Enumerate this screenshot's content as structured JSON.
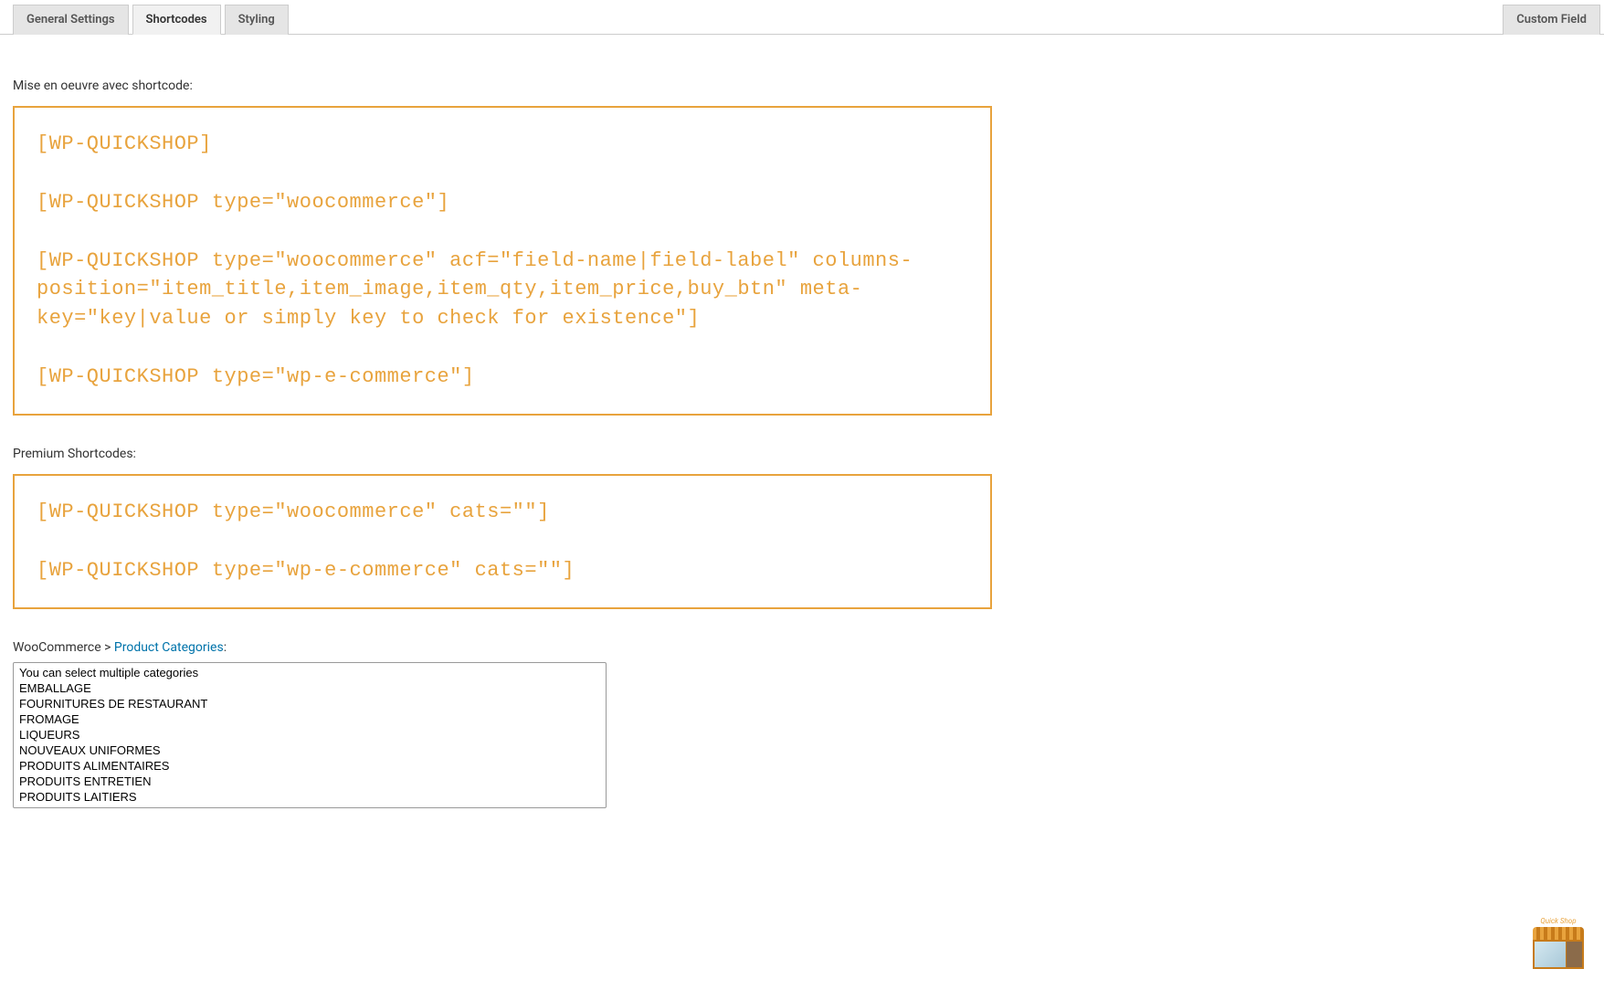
{
  "tabs": {
    "left": [
      {
        "label": "General Settings",
        "active": false
      },
      {
        "label": "Shortcodes",
        "active": true
      },
      {
        "label": "Styling",
        "active": false
      }
    ],
    "right": {
      "label": "Custom Field"
    }
  },
  "sections": {
    "shortcode_label": "Mise en oeuvre avec shortcode:",
    "shortcode_code": "[WP-QUICKSHOP]\n\n[WP-QUICKSHOP type=\"woocommerce\"]\n\n[WP-QUICKSHOP type=\"woocommerce\" acf=\"field-name|field-label\" columns-position=\"item_title,item_image,item_qty,item_price,buy_btn\" meta-key=\"key|value or simply key to check for existence\"]\n\n[WP-QUICKSHOP type=\"wp-e-commerce\"]",
    "premium_label": "Premium Shortcodes:",
    "premium_code": "[WP-QUICKSHOP type=\"woocommerce\" cats=\"\"]\n\n[WP-QUICKSHOP type=\"wp-e-commerce\" cats=\"\"]",
    "breadcrumb_prefix": "WooCommerce > ",
    "breadcrumb_link": "Product Categories",
    "breadcrumb_suffix": ":"
  },
  "categories": [
    "You can select multiple categories",
    "EMBALLAGE",
    "FOURNITURES DE RESTAURANT",
    "FROMAGE",
    "LIQUEURS",
    "NOUVEAUX UNIFORMES",
    "PRODUITS ALIMENTAIRES",
    "PRODUITS ENTRETIEN",
    "PRODUITS LAITIERS"
  ],
  "logo": {
    "text": "Quick Shop"
  }
}
